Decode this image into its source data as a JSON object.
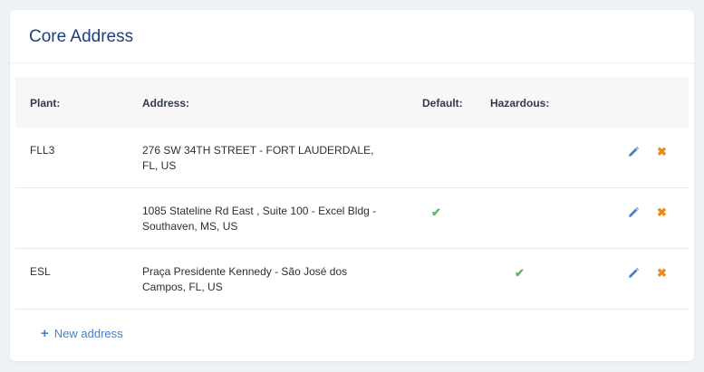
{
  "card": {
    "title": "Core Address"
  },
  "table": {
    "headers": {
      "plant": "Plant:",
      "address": "Address:",
      "default": "Default:",
      "hazardous": "Hazardous:"
    },
    "rows": [
      {
        "plant": "FLL3",
        "address": "276 SW 34TH STREET - FORT LAUDERDALE, FL, US",
        "default": false,
        "hazardous": false
      },
      {
        "plant": "",
        "address": "1085 Stateline Rd East , Suite 100 - Excel Bldg - Southaven, MS, US",
        "default": true,
        "hazardous": false
      },
      {
        "plant": "ESL",
        "address": "Praça Presidente Kennedy - São José dos Campos, FL, US",
        "default": false,
        "hazardous": true
      }
    ]
  },
  "icons": {
    "check": "check-icon",
    "edit": "pencil-icon",
    "delete": "close-icon",
    "add": "plus-icon"
  },
  "colors": {
    "title": "#1f3f7a",
    "link": "#4a7fc1",
    "check": "#5cb85c",
    "edit": "#4a7fc1",
    "delete": "#e8891a"
  },
  "actions": {
    "add_label": "New address",
    "add_symbol": "+"
  },
  "glyphs": {
    "check": "✔",
    "delete": "✖"
  }
}
